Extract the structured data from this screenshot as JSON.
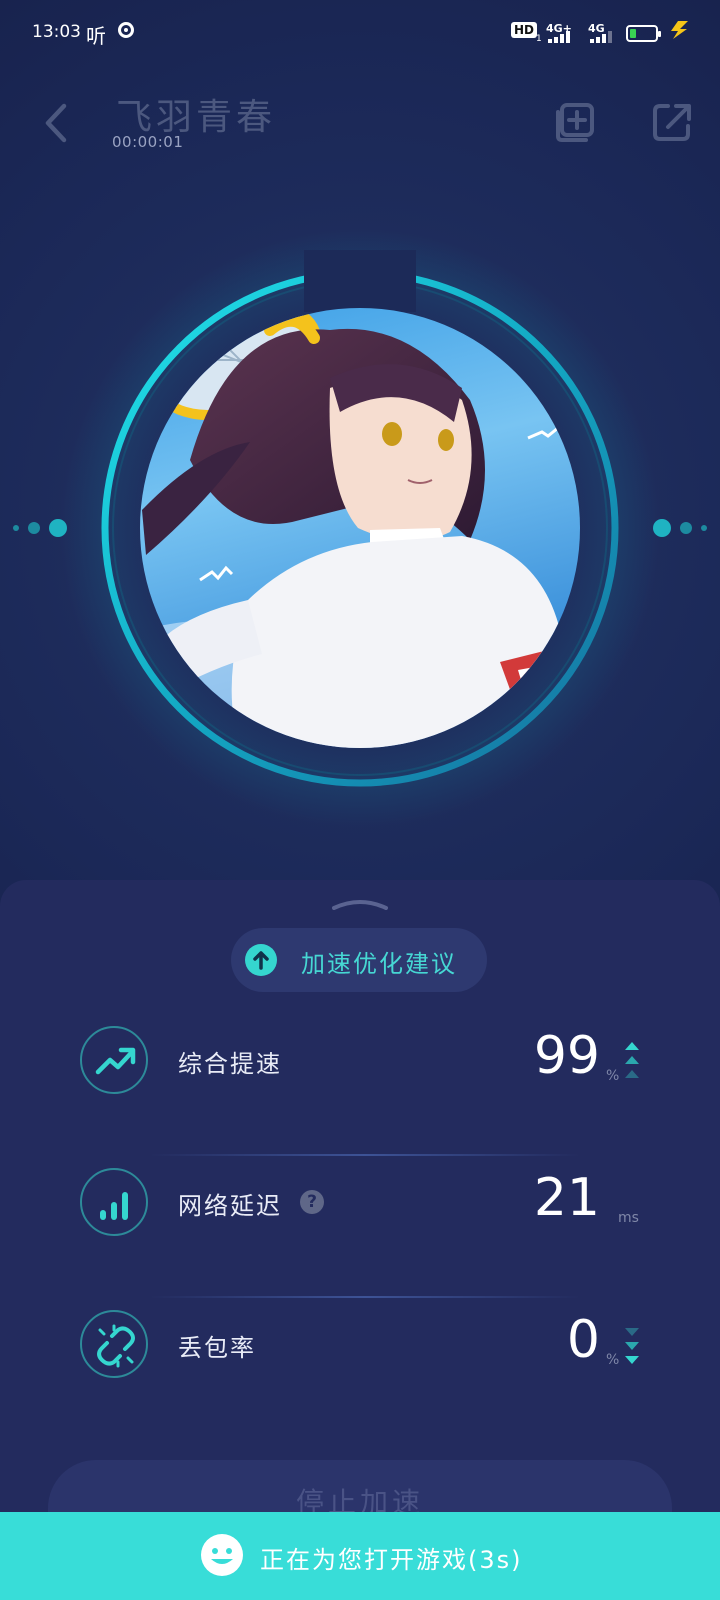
{
  "status_bar": {
    "time": "13:03",
    "listen_glyph": "听",
    "hd_label": "HD",
    "hd_sub": "1",
    "network_1": "4G+",
    "network_2": "4G",
    "battery_level": 0.25,
    "battery_color": "#39d353"
  },
  "header": {
    "title": "飞羽青春",
    "timer": "00:00:01",
    "back_icon": "chevron-left-icon",
    "actions": [
      {
        "icon": "add-shortcut-icon"
      },
      {
        "icon": "share-icon"
      }
    ]
  },
  "hero": {
    "image": "game-cover-art",
    "ring_color": "#17c3d1"
  },
  "tips": {
    "label": "加速优化建议",
    "icon": "arrow-up-circle-icon"
  },
  "stats": [
    {
      "label": "综合提速",
      "value": "99",
      "unit": "%",
      "icon": "trending-up-icon",
      "trend": "up"
    },
    {
      "label": "网络延迟",
      "value": "21",
      "unit": "ms",
      "icon": "signal-bars-icon",
      "help": "?"
    },
    {
      "label": "丢包率",
      "value": "0",
      "unit": "%",
      "icon": "broken-link-icon",
      "trend": "down"
    }
  ],
  "stop_button": {
    "label": "停止加速"
  },
  "banner": {
    "label": "正在为您打开游戏(3s)",
    "icon": "smile-icon",
    "color": "#38ddd8"
  },
  "colors": {
    "accent": "#35d6cf",
    "background": "#17214b",
    "sheet": "#232b5e"
  }
}
